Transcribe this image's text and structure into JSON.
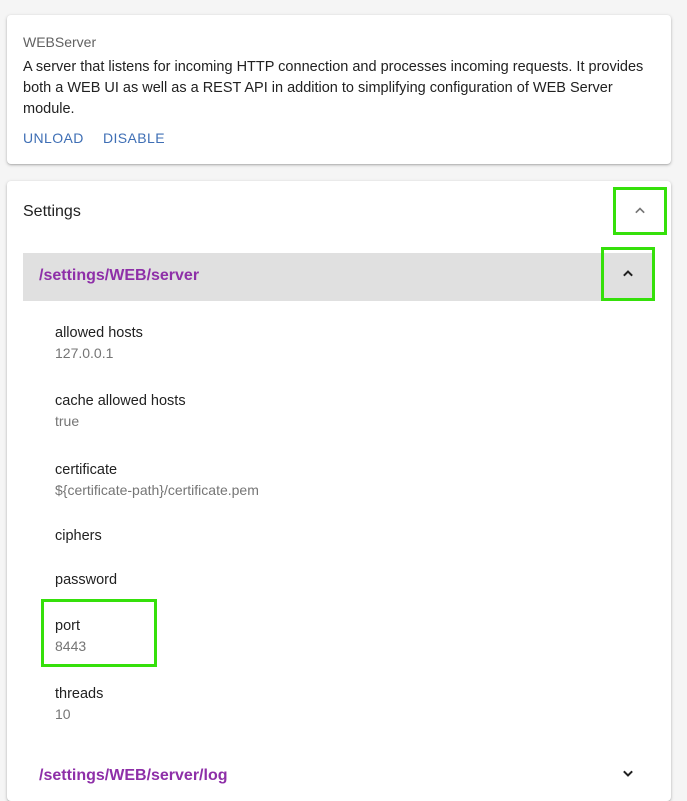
{
  "module": {
    "name": "WEBServer",
    "description": "A server that listens for incoming HTTP connection and processes incoming requests. It provides both a WEB UI as well as a REST API in addition to simplifying configuration of WEB Server module.",
    "actions": {
      "unload": "UNLOAD",
      "disable": "DISABLE"
    }
  },
  "settings": {
    "title": "Settings",
    "toggle_icon": "chevron-up-icon",
    "panels": [
      {
        "title": "/settings/WEB/server",
        "expanded": true,
        "toggle_icon": "chevron-up-icon",
        "items": [
          {
            "key": "allowed hosts",
            "value": "127.0.0.1"
          },
          {
            "key": "cache allowed hosts",
            "value": "true"
          },
          {
            "key": "certificate",
            "value": "${certificate-path}/certificate.pem"
          },
          {
            "key": "ciphers",
            "value": ""
          },
          {
            "key": "password",
            "value": ""
          },
          {
            "key": "port",
            "value": "8443"
          },
          {
            "key": "threads",
            "value": "10"
          }
        ]
      },
      {
        "title": "/settings/WEB/server/log",
        "expanded": false,
        "toggle_icon": "chevron-down-icon"
      }
    ]
  },
  "colors": {
    "accent_link": "#3f6fb5",
    "panel_title": "#8e2fa8",
    "highlight": "#35e00a",
    "panel_header_bg": "#e0e0e0"
  }
}
